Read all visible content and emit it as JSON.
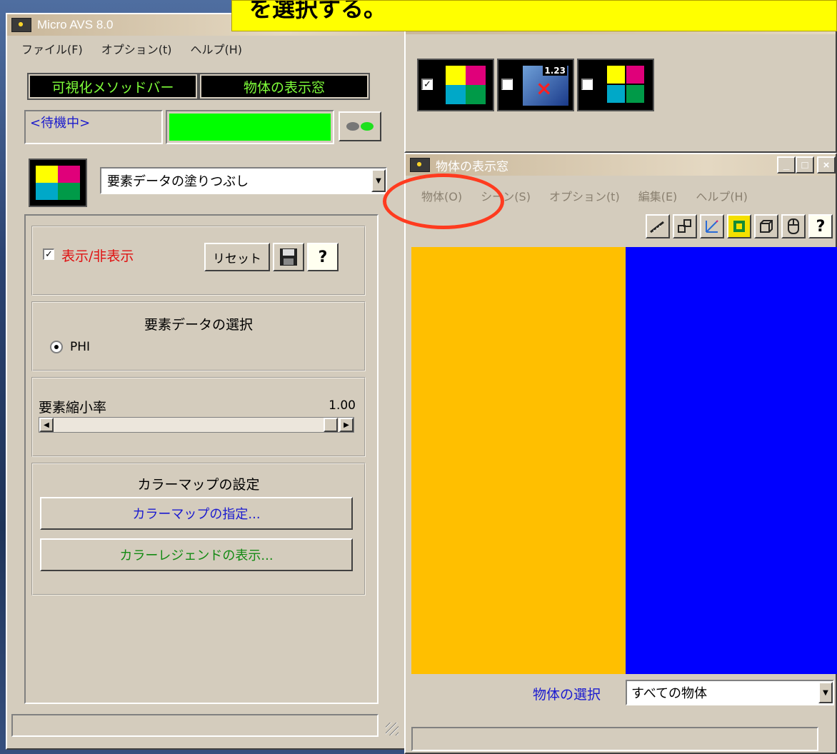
{
  "banner": {
    "text": "を選択する。"
  },
  "left_window": {
    "title": "Micro AVS 8.0",
    "menu": [
      "ファイル(F)",
      "オプション(t)",
      "ヘルプ(H)"
    ],
    "buttons": {
      "method_bar": "可視化メソッドバー",
      "object_window": "物体の表示窓"
    },
    "status_text": "<待機中>",
    "method_select": {
      "value": "要素データの塗りつぶし"
    },
    "visibility": {
      "label": "表示/非表示",
      "checked": true
    },
    "reset_label": "リセット",
    "help_label": "?",
    "element_data": {
      "title": "要素データの選択",
      "option": "PHI"
    },
    "shrink": {
      "label": "要素縮小率",
      "value": "1.00"
    },
    "colormap": {
      "title": "カラーマップの設定",
      "specify": "カラーマップの指定...",
      "legend": "カラーレジェンドの表示..."
    }
  },
  "method_bar": {
    "icons": [
      {
        "name": "fill-method-icon",
        "checked": true
      },
      {
        "name": "value-display-icon",
        "checked": false,
        "badge": "1.23"
      },
      {
        "name": "mesh-method-icon",
        "checked": false
      }
    ]
  },
  "object_window": {
    "title": "物体の表示窓",
    "menu": [
      "物体(O)",
      "シーン(S)",
      "オプション(t)",
      "編集(E)",
      "ヘルプ(H)"
    ],
    "window_controls": [
      "_",
      "□",
      "×"
    ],
    "toolbar": [
      "ruler-icon",
      "arrange-icon",
      "axis-icon",
      "fit-icon",
      "box-icon",
      "mouse-icon",
      "help-icon"
    ],
    "help_glyph": "?",
    "canvas_colors": {
      "left": "#ffbf00",
      "right": "#0000ff"
    },
    "object_select": {
      "label": "物体の選択",
      "value": "すべての物体"
    }
  },
  "colors": {
    "accent_green": "#00ff00",
    "highlight_red": "#ff3b1f",
    "banner_yellow": "#ffff00"
  }
}
